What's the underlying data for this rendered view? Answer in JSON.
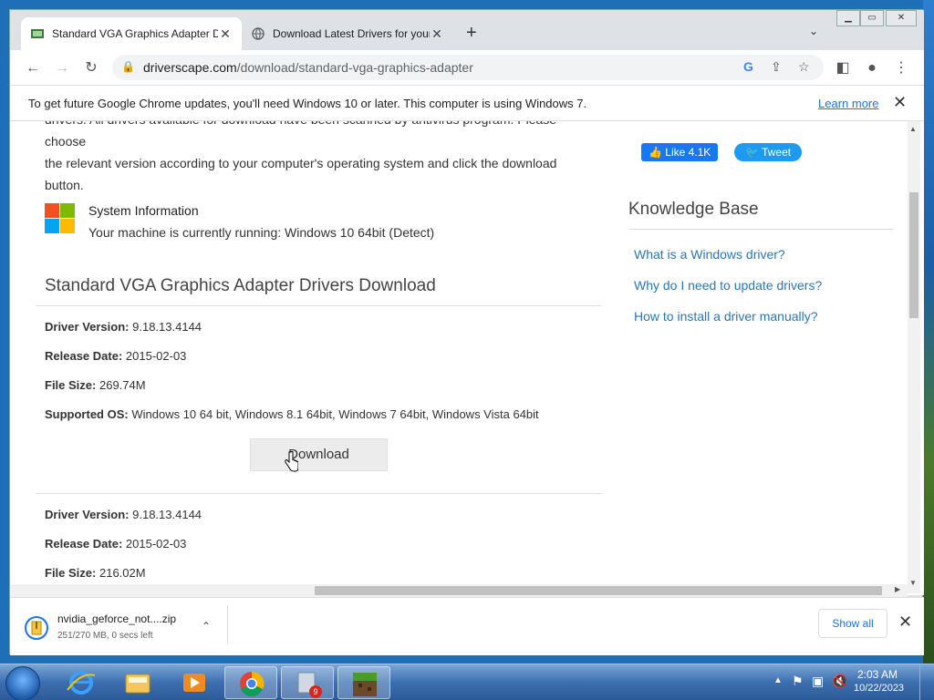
{
  "tabs": [
    {
      "title": "Standard VGA Graphics Adapter D",
      "active": true
    },
    {
      "title": "Download Latest Drivers for your",
      "active": false
    }
  ],
  "toolbar": {
    "url_domain": "driverscape.com",
    "url_path": "/download/standard-vga-graphics-adapter"
  },
  "infobar": {
    "message": "To get future Google Chrome updates, you'll need Windows 10 or later. This computer is using Windows 7.",
    "learn_more": "Learn more"
  },
  "page": {
    "intro_cut": "drivers. All drivers available for download have been scanned by antivirus program. Please choose",
    "intro_line2": "the relevant version according to your computer's operating system and click the download",
    "intro_line3": "button.",
    "sys_title": "System Information",
    "sys_line": "Your machine is currently running: Windows 10 64bit (Detect)",
    "section_title": "Standard VGA Graphics Adapter Drivers Download",
    "driver1": {
      "version_label": "Driver Version:",
      "version": "9.18.13.4144",
      "date_label": "Release Date:",
      "date": "2015-02-03",
      "size_label": "File Size:",
      "size": "269.74M",
      "os_label": "Supported OS:",
      "os": "Windows 10 64 bit, Windows 8.1 64bit, Windows 7 64bit, Windows Vista 64bit"
    },
    "download_label": "Download",
    "driver2": {
      "version_label": "Driver Version:",
      "version": "9.18.13.4144",
      "date_label": "Release Date:",
      "date": "2015-02-03",
      "size_label": "File Size:",
      "size": "216.02M"
    }
  },
  "sidebar": {
    "like_label": "Like 4.1K",
    "tweet_label": "Tweet",
    "kb_title": "Knowledge Base",
    "links": [
      "What is a Windows driver?",
      "Why do I need to update drivers?",
      "How to install a driver manually?"
    ]
  },
  "downloads": {
    "file_name": "nvidia_geforce_not....zip",
    "status": "251/270 MB, 0 secs left",
    "show_all": "Show all"
  },
  "taskbar": {
    "badge": "9",
    "time": "2:03 AM",
    "date": "10/22/2023"
  },
  "colors": {
    "link": "#2a76b8",
    "chrome_blue": "#1a73e8",
    "facebook": "#1877f2",
    "twitter": "#1d9bf0"
  }
}
